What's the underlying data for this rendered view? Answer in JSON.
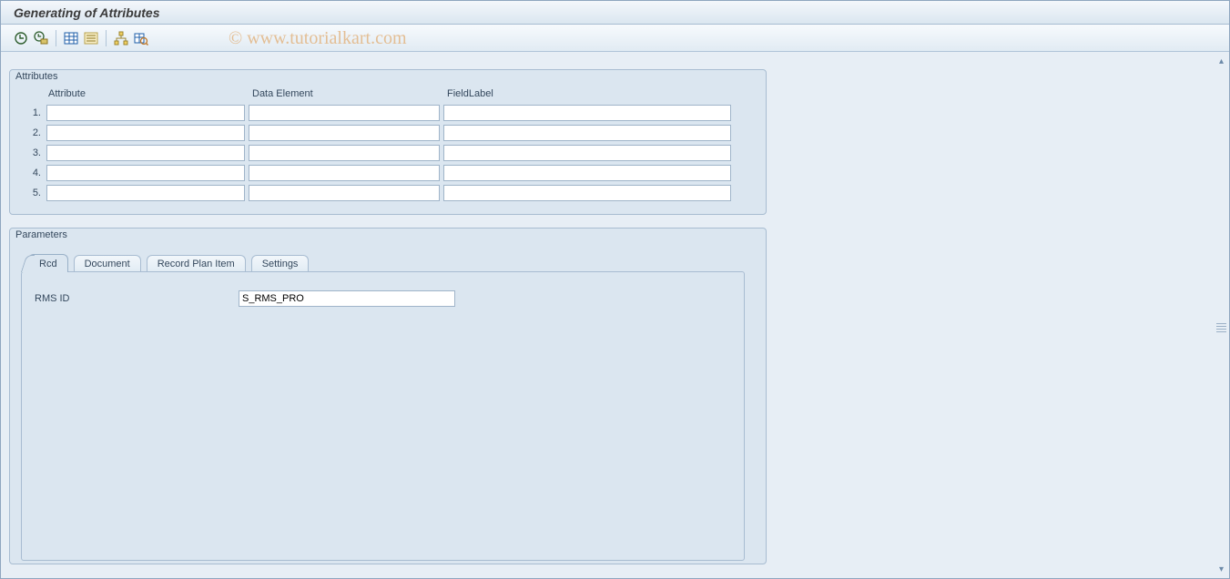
{
  "title": "Generating of Attributes",
  "watermark": "©  www.tutorialkart.com",
  "toolbar": {
    "icons": [
      {
        "name": "execute-icon"
      },
      {
        "name": "execute-print-icon"
      },
      {
        "name": "table-contents-icon"
      },
      {
        "name": "list-icon"
      },
      {
        "name": "hierarchy-icon"
      },
      {
        "name": "inspect-icon"
      }
    ]
  },
  "groups": {
    "attributes": {
      "legend": "Attributes",
      "headers": {
        "attribute": "Attribute",
        "dataElement": "Data Element",
        "fieldLabel": "FieldLabel"
      },
      "rows": [
        {
          "num": "1.",
          "attribute": "",
          "dataElement": "",
          "fieldLabel": ""
        },
        {
          "num": "2.",
          "attribute": "",
          "dataElement": "",
          "fieldLabel": ""
        },
        {
          "num": "3.",
          "attribute": "",
          "dataElement": "",
          "fieldLabel": ""
        },
        {
          "num": "4.",
          "attribute": "",
          "dataElement": "",
          "fieldLabel": ""
        },
        {
          "num": "5.",
          "attribute": "",
          "dataElement": "",
          "fieldLabel": ""
        }
      ]
    },
    "parameters": {
      "legend": "Parameters",
      "tabs": [
        {
          "id": "rcd",
          "label": "Rcd",
          "active": true
        },
        {
          "id": "document",
          "label": "Document",
          "active": false
        },
        {
          "id": "recordPlanItem",
          "label": "Record Plan Item",
          "active": false
        },
        {
          "id": "settings",
          "label": "Settings",
          "active": false
        }
      ],
      "panel": {
        "fields": [
          {
            "label": "RMS ID",
            "value": "S_RMS_PRO"
          }
        ]
      }
    }
  }
}
